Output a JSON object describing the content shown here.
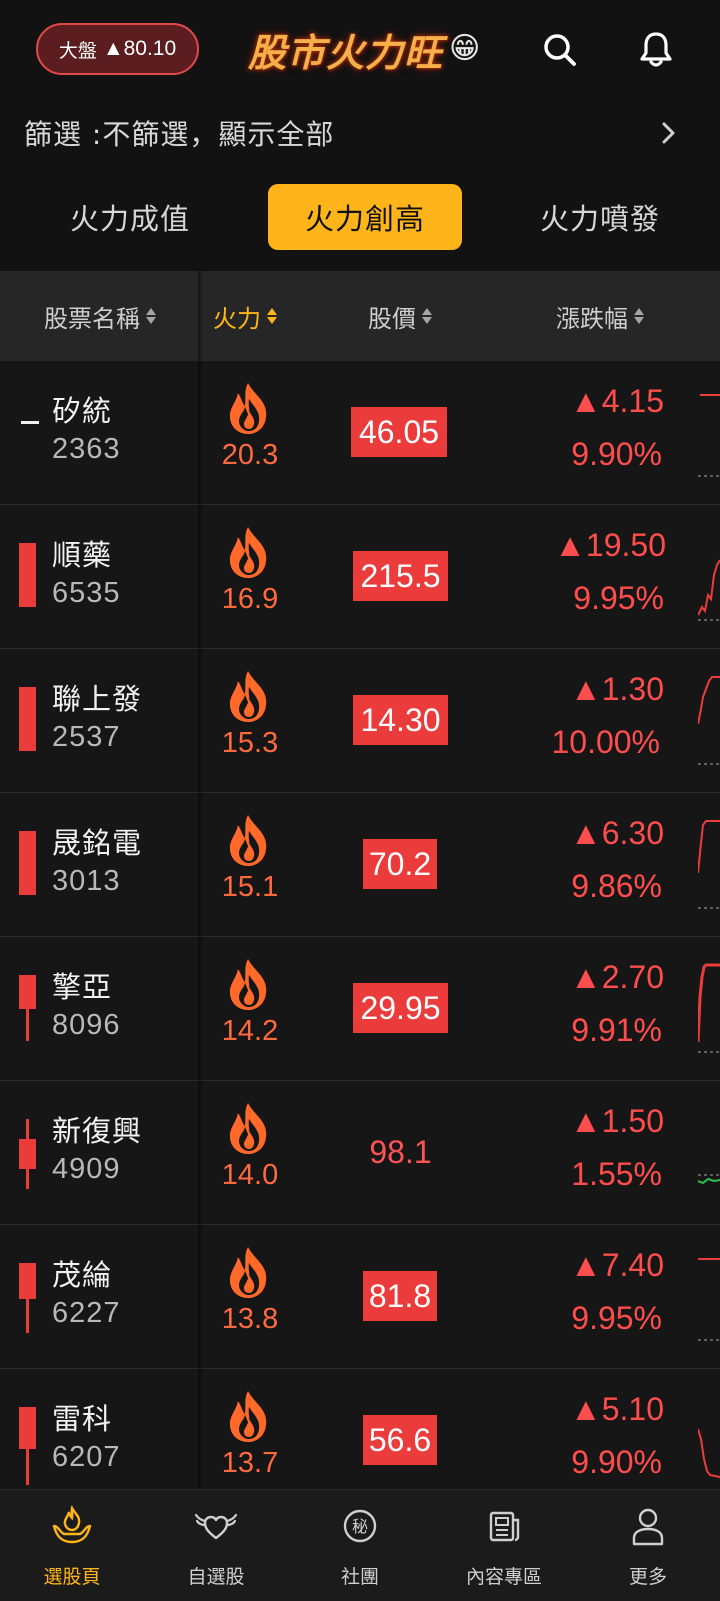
{
  "header": {
    "index_label": "大盤",
    "index_value": "▲80.10",
    "logo_text": "股市火力旺",
    "logo_emoji": "😁",
    "search_icon": "search-icon",
    "bell_icon": "bell-icon"
  },
  "filter": {
    "text": "篩選 :不篩選，顯示全部"
  },
  "tabs": [
    {
      "label": "火力成值"
    },
    {
      "label": "火力創高"
    },
    {
      "label": "火力噴發"
    }
  ],
  "table": {
    "headers": {
      "name": "股票名稱",
      "fire": "火力",
      "price": "股價",
      "change": "漲跌幅"
    },
    "rows": [
      {
        "name": "矽統",
        "code": "2363",
        "fire": "20.3",
        "price": "46.05",
        "price_highlight": true,
        "change": "▲4.15",
        "pct": "9.90%"
      },
      {
        "name": "順藥",
        "code": "6535",
        "fire": "16.9",
        "price": "215.5",
        "price_highlight": true,
        "change": "▲19.50",
        "pct": "9.95%"
      },
      {
        "name": "聯上發",
        "code": "2537",
        "fire": "15.3",
        "price": "14.30",
        "price_highlight": true,
        "change": "▲1.30",
        "pct": "10.00%"
      },
      {
        "name": "晟銘電",
        "code": "3013",
        "fire": "15.1",
        "price": "70.2",
        "price_highlight": true,
        "change": "▲6.30",
        "pct": "9.86%"
      },
      {
        "name": "擎亞",
        "code": "8096",
        "fire": "14.2",
        "price": "29.95",
        "price_highlight": true,
        "change": "▲2.70",
        "pct": "9.91%"
      },
      {
        "name": "新復興",
        "code": "4909",
        "fire": "14.0",
        "price": "98.1",
        "price_highlight": false,
        "change": "▲1.50",
        "pct": "1.55%"
      },
      {
        "name": "茂綸",
        "code": "6227",
        "fire": "13.8",
        "price": "81.8",
        "price_highlight": true,
        "change": "▲7.40",
        "pct": "9.95%"
      },
      {
        "name": "雷科",
        "code": "6207",
        "fire": "13.7",
        "price": "56.6",
        "price_highlight": true,
        "change": "▲5.10",
        "pct": "9.90%"
      }
    ]
  },
  "bottom_nav": [
    {
      "label": "選股頁",
      "icon": "hand-fire-icon",
      "active": true
    },
    {
      "label": "自選股",
      "icon": "winged-heart-icon",
      "active": false
    },
    {
      "label": "社團",
      "icon": "secret-badge-icon",
      "icon_text": "秘",
      "active": false
    },
    {
      "label": "內容專區",
      "icon": "newspaper-icon",
      "active": false
    },
    {
      "label": "更多",
      "icon": "person-icon",
      "active": false
    }
  ],
  "colors": {
    "accent": "#ffb51a",
    "up_red": "#ec3b3b",
    "background": "#121212",
    "fire_orange": "#ff6a3d"
  }
}
